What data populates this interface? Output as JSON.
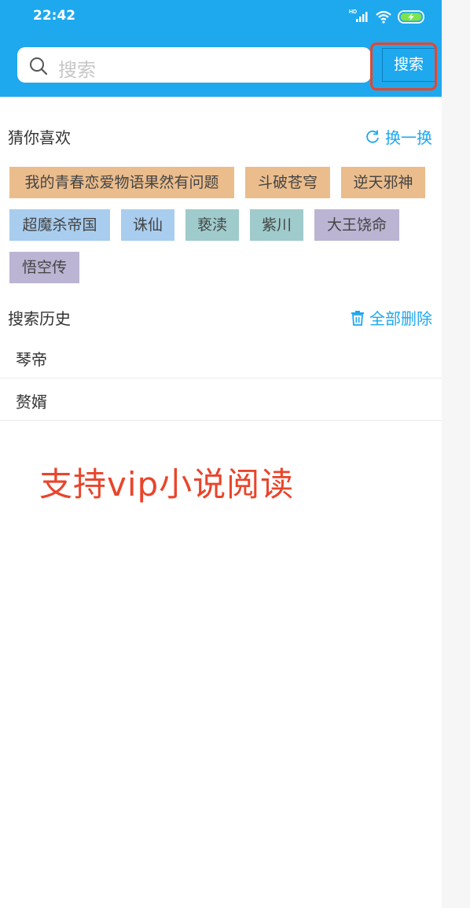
{
  "status_bar": {
    "time": "22:42",
    "icons": [
      "signal-icon",
      "wifi-icon",
      "battery-charging-icon"
    ]
  },
  "search": {
    "placeholder": "搜索",
    "button_label": "搜索"
  },
  "recommend": {
    "title": "猜你喜欢",
    "refresh_label": "换一换",
    "tags": [
      {
        "label": "我的青春恋爱物语果然有问题",
        "color": "#ebbd8d"
      },
      {
        "label": "斗破苍穹",
        "color": "#ebbd8d"
      },
      {
        "label": "逆天邪神",
        "color": "#ebbd8d"
      },
      {
        "label": "超魔杀帝国",
        "color": "#a9cdee"
      },
      {
        "label": "诛仙",
        "color": "#a9cdee"
      },
      {
        "label": "亵渎",
        "color": "#9fcbcc"
      },
      {
        "label": "紫川",
        "color": "#9fcbcc"
      },
      {
        "label": "大王饶命",
        "color": "#bcb4d3"
      },
      {
        "label": "悟空传",
        "color": "#bcb4d3"
      }
    ]
  },
  "history": {
    "title": "搜索历史",
    "clear_label": "全部删除",
    "items": [
      "琴帝",
      "赘婿"
    ]
  },
  "promo": {
    "text": "支持vip小说阅读"
  },
  "colors": {
    "header_bg": "#1ea8ee",
    "accent": "#1ea8ee",
    "highlight": "#e8452c",
    "promo": "#e9452b"
  }
}
